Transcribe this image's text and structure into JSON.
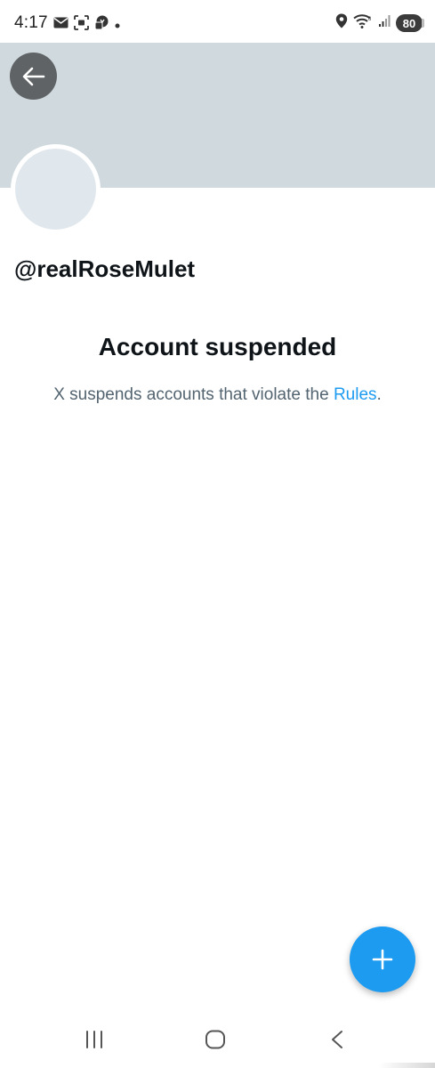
{
  "status_bar": {
    "time": "4:17",
    "battery": "80",
    "left_icons": [
      "mail-icon",
      "screenshot-icon",
      "messenger-icon",
      "notification-dot"
    ],
    "right_icons": [
      "location-icon",
      "wifi-icon",
      "signal-icon",
      "battery-icon"
    ]
  },
  "profile": {
    "handle": "@realRoseMulet",
    "banner_color": "#cfd9de",
    "avatar_color": "#e1e8ed"
  },
  "suspension": {
    "title": "Account suspended",
    "message_prefix": "X suspends accounts that violate the ",
    "rules_link": "Rules",
    "message_suffix": "."
  },
  "colors": {
    "accent": "#1d9bf0",
    "text_primary": "#0f1419",
    "text_secondary": "#536471"
  },
  "fab": {
    "icon": "plus-icon"
  },
  "navigation": {
    "buttons": [
      "recents-icon",
      "home-icon",
      "back-icon"
    ]
  }
}
